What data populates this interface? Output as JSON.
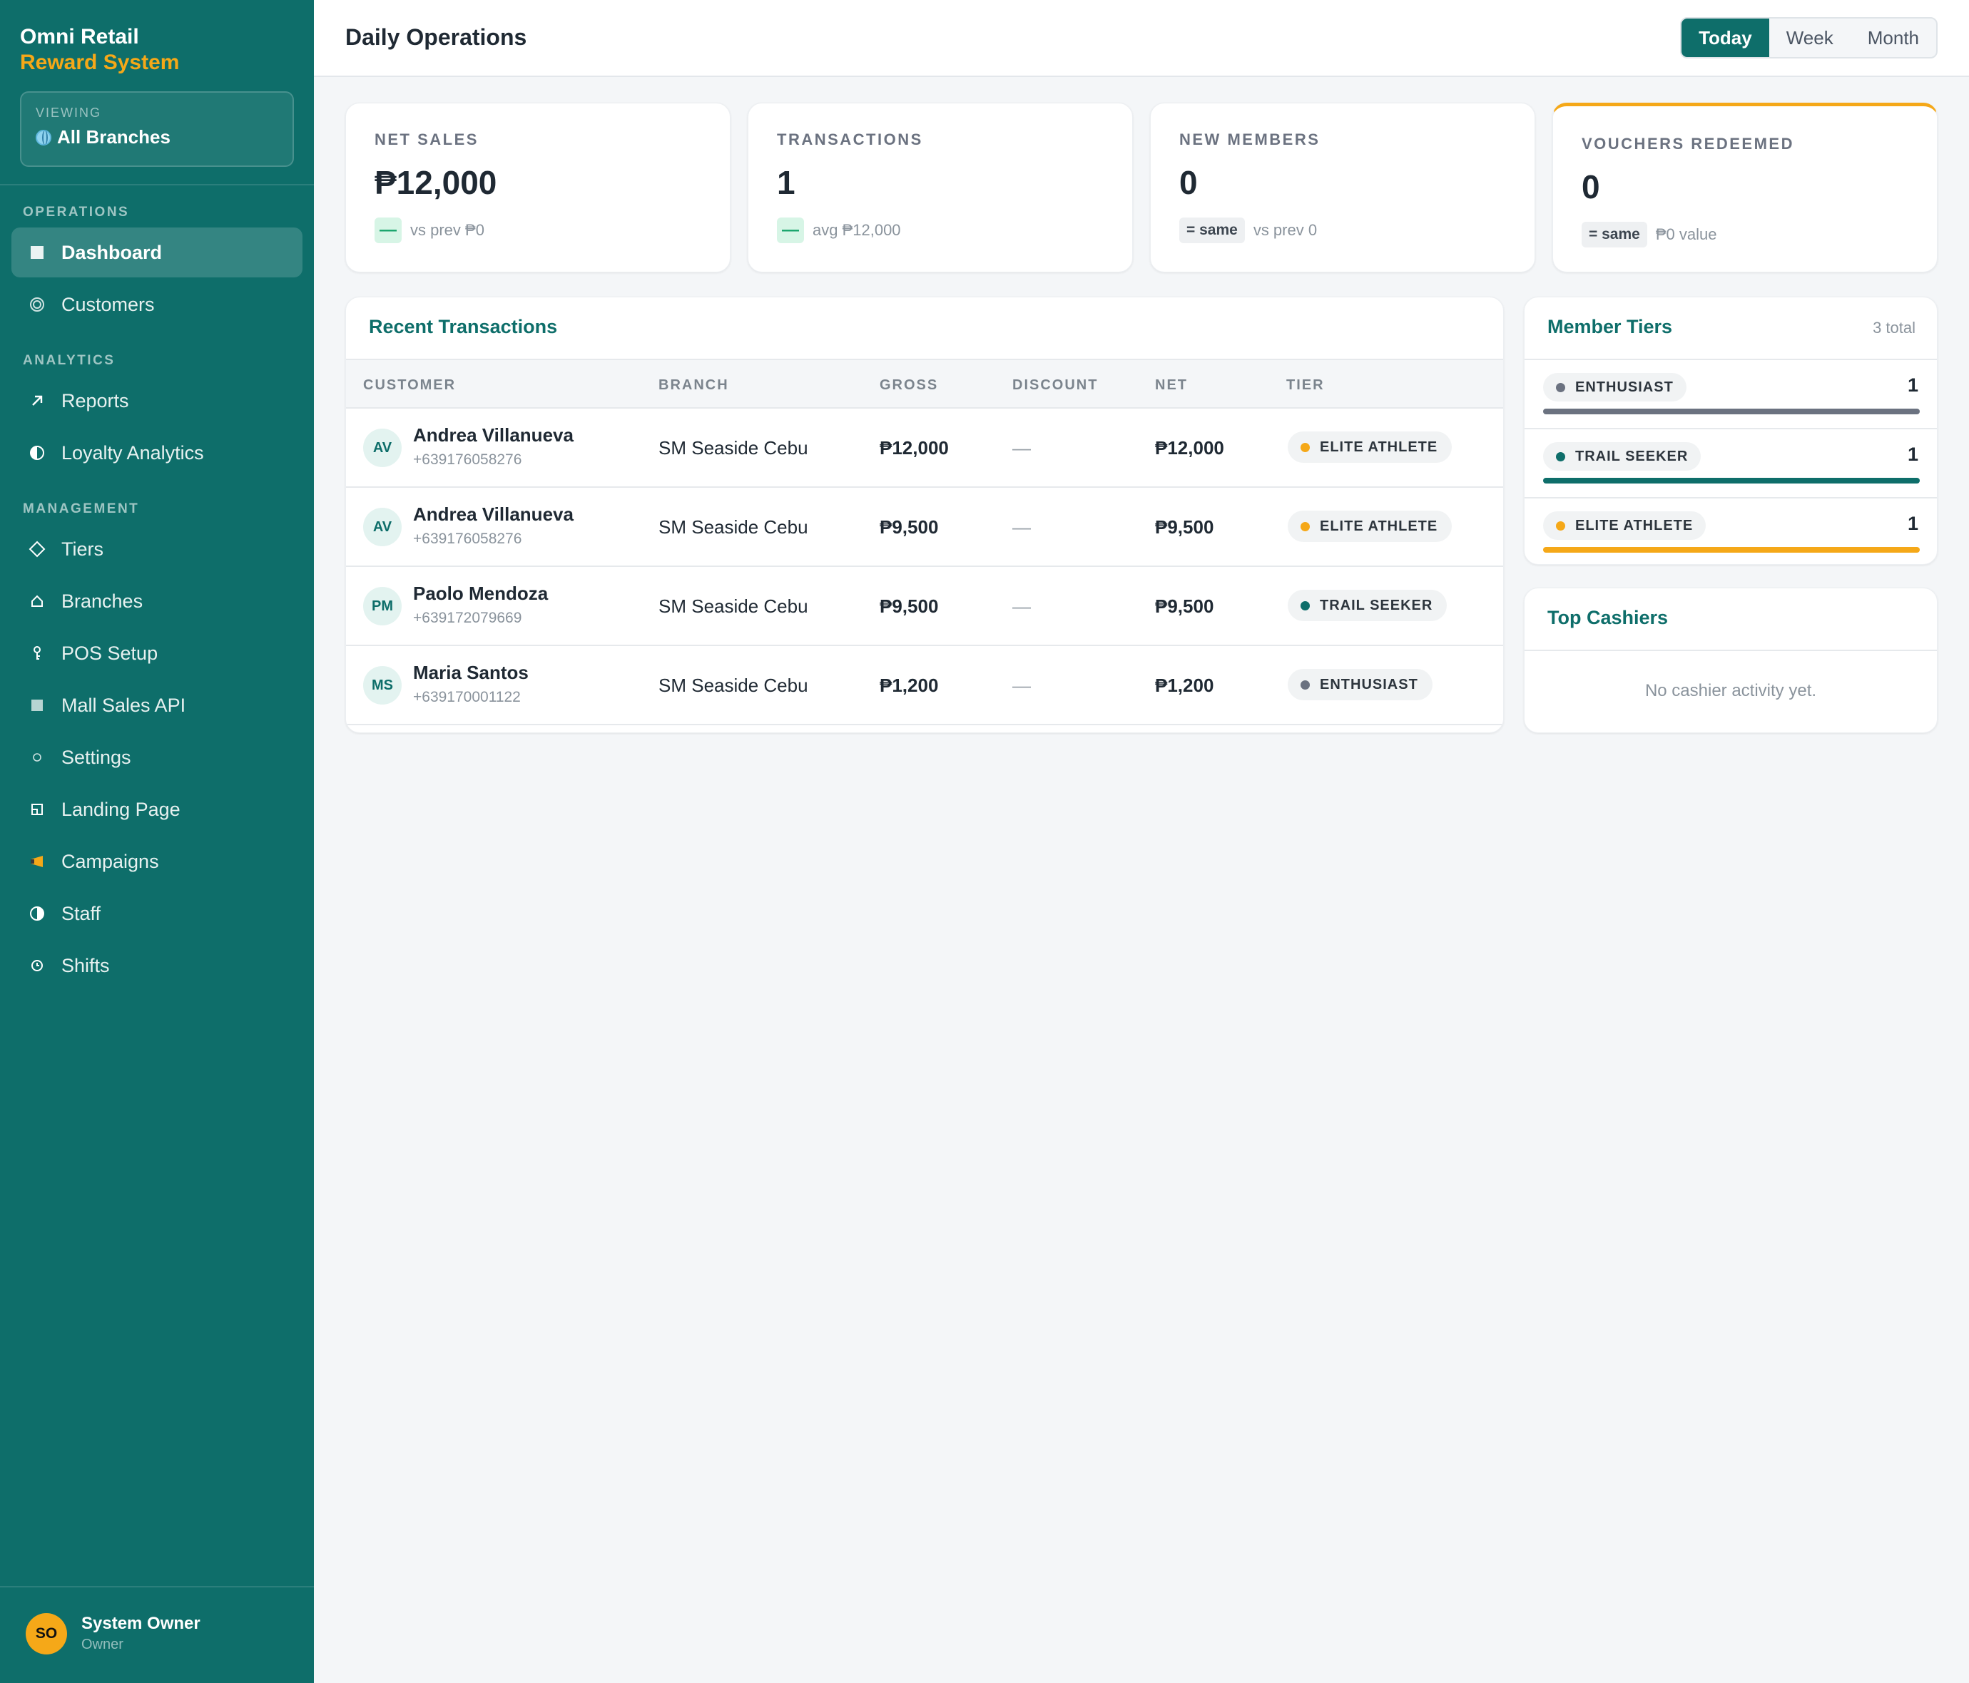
{
  "brand": {
    "line1": "Omni Retail",
    "line2": "Reward System"
  },
  "viewing": {
    "caption": "VIEWING",
    "value": "All Branches"
  },
  "sidebar": {
    "sections": [
      {
        "title": "OPERATIONS",
        "items": [
          {
            "label": "Dashboard",
            "icon": "square-icon",
            "active": true
          },
          {
            "label": "Customers",
            "icon": "ring-icon"
          }
        ]
      },
      {
        "title": "ANALYTICS",
        "items": [
          {
            "label": "Reports",
            "icon": "arrow-up-right-icon"
          },
          {
            "label": "Loyalty Analytics",
            "icon": "half-circle-icon"
          }
        ]
      },
      {
        "title": "MANAGEMENT",
        "items": [
          {
            "label": "Tiers",
            "icon": "diamond-icon"
          },
          {
            "label": "Branches",
            "icon": "home-icon"
          },
          {
            "label": "POS Setup",
            "icon": "key-icon"
          },
          {
            "label": "Mall Sales API",
            "icon": "grid-icon"
          },
          {
            "label": "Settings",
            "icon": "gear-icon"
          },
          {
            "label": "Landing Page",
            "icon": "page-icon"
          },
          {
            "label": "Campaigns",
            "icon": "megaphone-icon"
          },
          {
            "label": "Staff",
            "icon": "contrast-icon"
          },
          {
            "label": "Shifts",
            "icon": "clock-icon"
          }
        ]
      }
    ]
  },
  "user": {
    "initials": "SO",
    "name": "System Owner",
    "role": "Owner"
  },
  "header": {
    "title": "Daily Operations",
    "ranges": [
      "Today",
      "Week",
      "Month"
    ],
    "selected_range": "Today"
  },
  "stats": [
    {
      "label": "NET SALES",
      "value": "₱12,000",
      "badge": "—",
      "note": "vs prev ₱0"
    },
    {
      "label": "TRANSACTIONS",
      "value": "1",
      "badge": "—",
      "note": "avg ₱12,000"
    },
    {
      "label": "NEW MEMBERS",
      "value": "0",
      "badge": "= same",
      "note": "vs prev 0"
    },
    {
      "label": "VOUCHERS REDEEMED",
      "value": "0",
      "badge": "= same",
      "note": "₱0 value"
    }
  ],
  "transactions": {
    "title": "Recent Transactions",
    "columns": [
      "CUSTOMER",
      "BRANCH",
      "GROSS",
      "DISCOUNT",
      "NET",
      "TIER"
    ],
    "rows": [
      {
        "initials": "AV",
        "name": "Andrea Villanueva",
        "phone": "+639176058276",
        "branch": "SM Seaside Cebu",
        "gross": "₱12,000",
        "discount": "—",
        "net": "₱12,000",
        "tier": "ELITE ATHLETE"
      },
      {
        "initials": "AV",
        "name": "Andrea Villanueva",
        "phone": "+639176058276",
        "branch": "SM Seaside Cebu",
        "gross": "₱9,500",
        "discount": "—",
        "net": "₱9,500",
        "tier": "ELITE ATHLETE"
      },
      {
        "initials": "PM",
        "name": "Paolo Mendoza",
        "phone": "+639172079669",
        "branch": "SM Seaside Cebu",
        "gross": "₱9,500",
        "discount": "—",
        "net": "₱9,500",
        "tier": "TRAIL SEEKER"
      },
      {
        "initials": "MS",
        "name": "Maria Santos",
        "phone": "+639170001122",
        "branch": "SM Seaside Cebu",
        "gross": "₱1,200",
        "discount": "—",
        "net": "₱1,200",
        "tier": "ENTHUSIAST"
      }
    ]
  },
  "member_tiers": {
    "title": "Member Tiers",
    "total": "3 total",
    "tiers": [
      {
        "name": "ENTHUSIAST",
        "count": "1",
        "share": 1.0
      },
      {
        "name": "TRAIL SEEKER",
        "count": "1",
        "share": 1.0
      },
      {
        "name": "ELITE ATHLETE",
        "count": "1",
        "share": 1.0
      }
    ]
  },
  "top_cashiers": {
    "title": "Top Cashiers",
    "empty": "No cashier activity yet."
  },
  "colors": {
    "sidebar": "#0e6e6a",
    "accent": "#f5a818",
    "teal": "#0e6e6a",
    "enthusiast": "#6b7280",
    "trail_seeker": "#0e6e6a",
    "elite_athlete": "#f5a818"
  }
}
